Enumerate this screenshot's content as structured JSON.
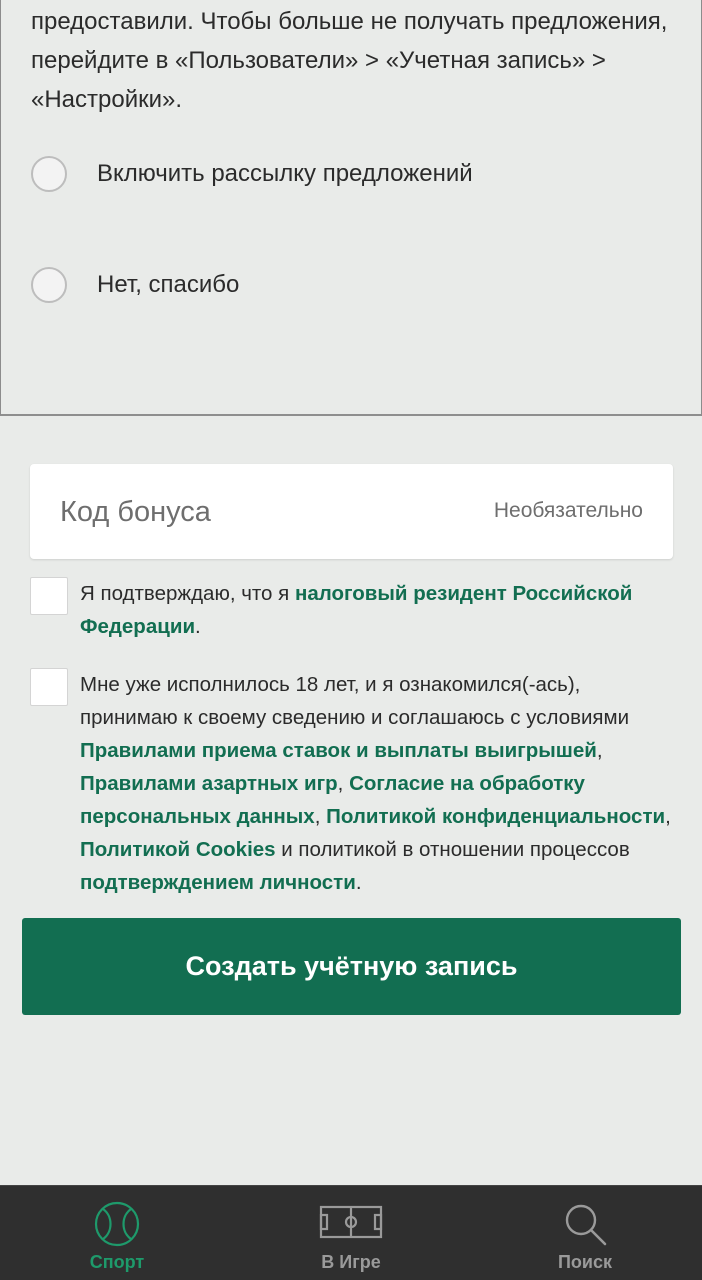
{
  "consent": {
    "paragraph": "предоставили. Чтобы больше не получать предложения, перейдите в «Пользователи» > «Учетная запись» > «Настройки».",
    "options": [
      {
        "label": "Включить рассылку предложений",
        "selected": false
      },
      {
        "label": "Нет, спасибо",
        "selected": false
      }
    ]
  },
  "bonus": {
    "placeholder": "Код бонуса",
    "optional_label": "Необязательно"
  },
  "tax_resident": {
    "text_before": "Я подтверждаю, что я ",
    "link": "налоговый резидент Российской Федерации",
    "text_after": "."
  },
  "age_terms": {
    "intro": "Мне уже исполнилось 18 лет, и я ознакомился(-ась), принимаю к своему сведению и соглашаюсь с условиями ",
    "link_betting_rules": "Правилами приема ставок и выплаты выигрышей",
    "sep1": ", ",
    "link_gambling_rules": "Правилами азартных игр",
    "sep2": ", ",
    "link_data_consent": "Согласие на обработку персональных данных",
    "sep3": ", ",
    "link_privacy": "Политикой конфиденциальности",
    "sep4": ", ",
    "link_cookies": "Политикой Cookies",
    "middle": " и политикой в отношении процессов ",
    "link_identity": "подтверждением личности",
    "end": "."
  },
  "create_button": "Создать учётную запись",
  "bottom_nav": {
    "items": [
      {
        "label": "Спорт",
        "icon": "tennis-ball-icon",
        "active": true
      },
      {
        "label": "В Игре",
        "icon": "football-pitch-icon",
        "active": false
      },
      {
        "label": "Поиск",
        "icon": "search-icon",
        "active": false
      }
    ]
  },
  "colors": {
    "brand_green": "#126e51",
    "active_nav": "#1e9a6b",
    "nav_background": "#2f2f2f",
    "page_background": "#e9ebe9"
  }
}
